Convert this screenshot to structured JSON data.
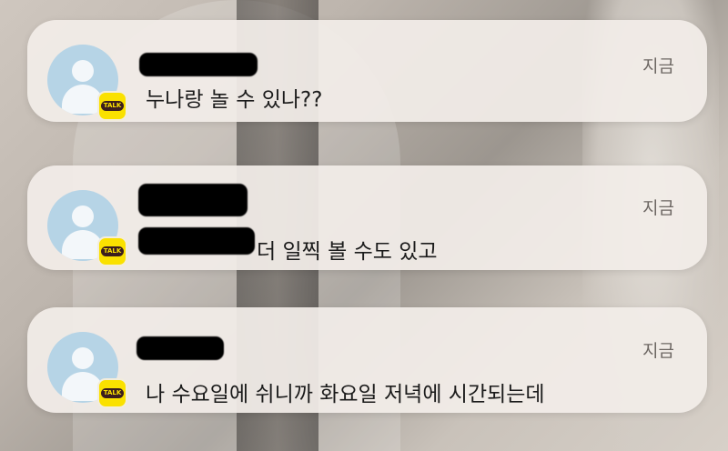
{
  "notifications": [
    {
      "app": "KakaoTalk",
      "badge_text": "TALK",
      "time": "지금",
      "message": "누나랑 놀 수 있나??",
      "sender_redacted": true
    },
    {
      "app": "KakaoTalk",
      "badge_text": "TALK",
      "time": "지금",
      "message": "더 일찍 볼 수도 있고",
      "sender_redacted": true
    },
    {
      "app": "KakaoTalk",
      "badge_text": "TALK",
      "time": "지금",
      "message": "나 수요일에 쉬니까 화요일 저녁에 시간되는데",
      "sender_redacted": true
    }
  ],
  "colors": {
    "kakao_yellow": "#fae100",
    "card_bg": "#f2ede8",
    "avatar_bg": "#b6d4e6"
  }
}
